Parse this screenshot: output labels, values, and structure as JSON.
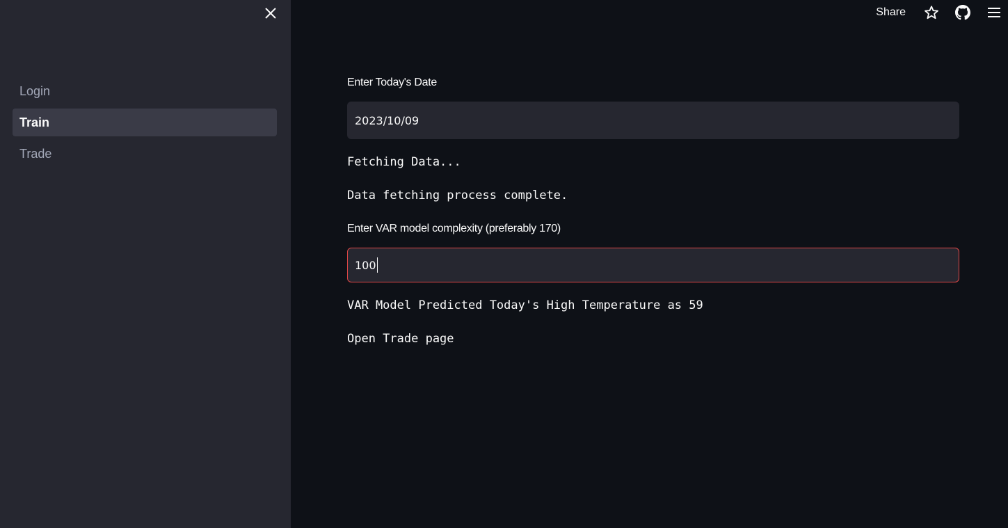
{
  "sidebar": {
    "close_icon": "close-icon",
    "items": [
      {
        "label": "Login",
        "active": false
      },
      {
        "label": "Train",
        "active": true
      },
      {
        "label": "Trade",
        "active": false
      }
    ]
  },
  "header": {
    "share_label": "Share",
    "icons": [
      "star-icon",
      "github-icon",
      "hamburger-menu-icon"
    ]
  },
  "main": {
    "date_label": "Enter Today's Date",
    "date_value": "2023/10/09",
    "status_fetching": "Fetching Data...",
    "status_complete": "Data fetching process complete.",
    "complexity_label": "Enter VAR model complexity (preferably 170)",
    "complexity_value": "100",
    "prediction_text": "VAR Model Predicted Today's High Temperature as 59",
    "open_trade_text": "Open Trade page"
  },
  "colors": {
    "sidebar_bg": "#262730",
    "main_bg": "#0e1117",
    "active_item_bg": "#3a3b47",
    "focus_border": "#e04747",
    "text": "#fafafa",
    "muted_text": "#a3a8b8"
  }
}
